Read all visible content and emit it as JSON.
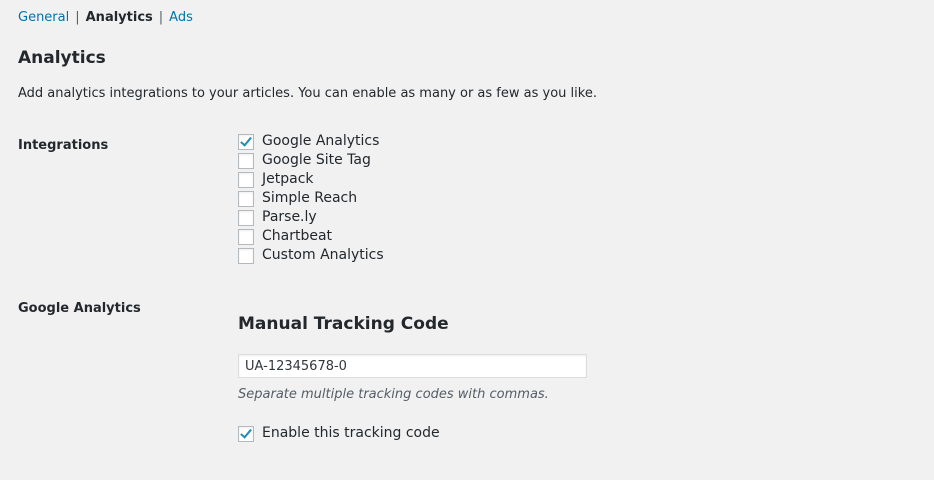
{
  "subnav": {
    "items": [
      {
        "label": "General",
        "current": false
      },
      {
        "label": "Analytics",
        "current": true
      },
      {
        "label": "Ads",
        "current": false
      }
    ],
    "separator": "|"
  },
  "page": {
    "title": "Analytics",
    "description": "Add analytics integrations to your articles. You can enable as many or as few as you like."
  },
  "integrations": {
    "label": "Integrations",
    "options": [
      {
        "label": "Google Analytics",
        "checked": true
      },
      {
        "label": "Google Site Tag",
        "checked": false
      },
      {
        "label": "Jetpack",
        "checked": false
      },
      {
        "label": "Simple Reach",
        "checked": false
      },
      {
        "label": "Parse.ly",
        "checked": false
      },
      {
        "label": "Chartbeat",
        "checked": false
      },
      {
        "label": "Custom Analytics",
        "checked": false
      }
    ]
  },
  "google_analytics": {
    "label": "Google Analytics",
    "heading": "Manual Tracking Code",
    "tracking_code_value": "UA-12345678-0",
    "hint": "Separate multiple tracking codes with commas.",
    "enable": {
      "label": "Enable this tracking code",
      "checked": true
    }
  },
  "colors": {
    "background": "#f1f1f1",
    "link": "#0073aa",
    "text": "#23282d",
    "checkmark": "#1e8cbe"
  }
}
